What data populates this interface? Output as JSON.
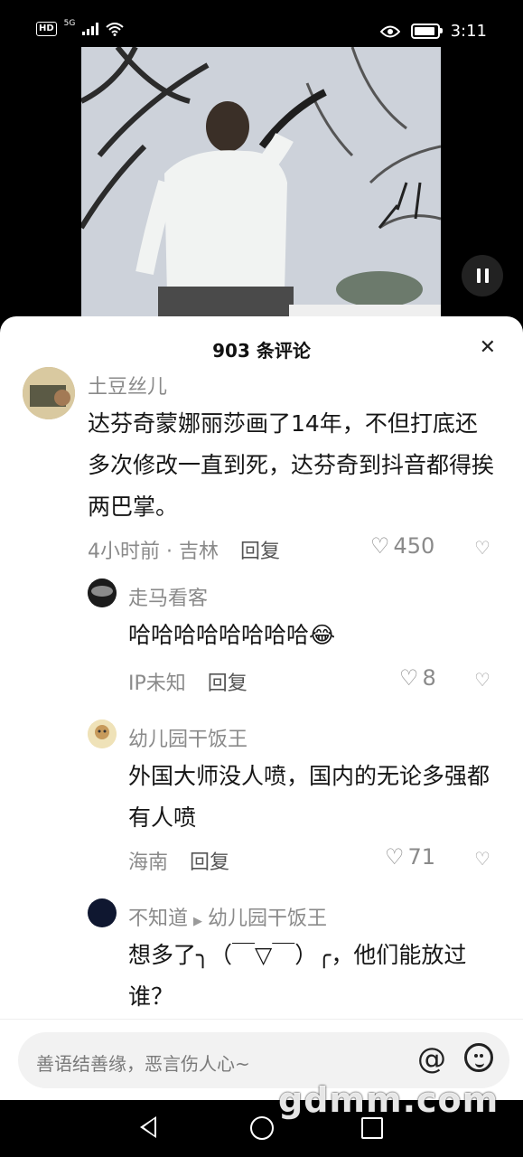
{
  "status_bar": {
    "hd": "HD",
    "network": "5G",
    "time": "3:11"
  },
  "sheet": {
    "title": "903 条评论",
    "close": "✕"
  },
  "comments": [
    {
      "user": "土豆丝儿",
      "text": "达芬奇蒙娜丽莎画了14年，不但打底还多次修改一直到死，达芬奇到抖音都得挨两巴掌。",
      "meta": "4小时前 · 吉林",
      "reply": "回复",
      "likes": "450"
    },
    {
      "user": "走马看客",
      "text": "哈哈哈哈哈哈哈哈😂",
      "meta": "IP未知",
      "reply": "回复",
      "likes": "8"
    },
    {
      "user": "幼儿园干饭王",
      "text": "外国大师没人喷，国内的无论多强都有人喷",
      "meta": "海南",
      "reply": "回复",
      "likes": "71"
    },
    {
      "user": "不知道",
      "reply_to": "幼儿园干饭王",
      "text": "想多了╮（￣▽￣）╭，他们能放过谁？"
    }
  ],
  "input": {
    "placeholder": "善语结善缘，恶言伤人心~",
    "at": "@"
  },
  "watermark": "gdmm.com"
}
